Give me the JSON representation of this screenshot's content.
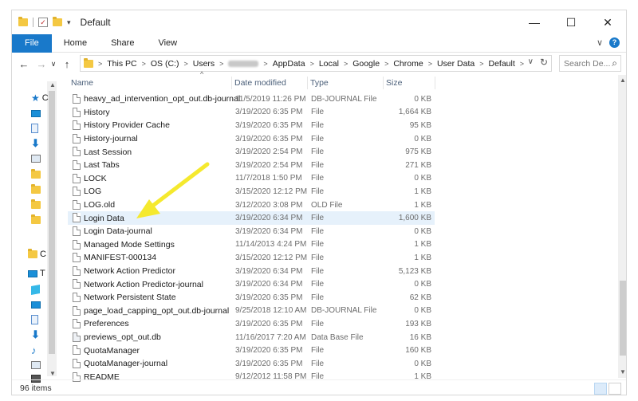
{
  "window": {
    "title": "Default",
    "minimize_glyph": "—",
    "maximize_glyph": "☐",
    "close_glyph": "✕"
  },
  "ribbon": {
    "tabs": [
      "File",
      "Home",
      "Share",
      "View"
    ],
    "collapse_glyph": "∨",
    "help_glyph": "?"
  },
  "nav": {
    "back_glyph": "←",
    "forward_glyph": "→",
    "recent_glyph": "∨",
    "up_glyph": "↑"
  },
  "address": {
    "crumbs": [
      "This PC",
      "OS (C:)",
      "Users",
      "",
      "AppData",
      "Local",
      "Google",
      "Chrome",
      "User Data",
      "Default"
    ],
    "dropdown_glyph": "∨",
    "refresh_glyph": "↻"
  },
  "search": {
    "placeholder": "Search De...",
    "icon_glyph": "⌕"
  },
  "navpane": {
    "items": [
      {
        "icon": "star-icon",
        "label": "C"
      },
      {
        "icon": "desktop-icon",
        "label": ""
      },
      {
        "icon": "documents-icon",
        "label": ""
      },
      {
        "icon": "downloads-icon",
        "label": ""
      },
      {
        "icon": "pictures-icon",
        "label": ""
      },
      {
        "icon": "folder-icon",
        "label": ""
      },
      {
        "icon": "folder-icon",
        "label": ""
      },
      {
        "icon": "folder-icon",
        "label": ""
      },
      {
        "icon": "folder-icon",
        "label": ""
      },
      {
        "icon": "folder-icon",
        "label": "C"
      },
      {
        "icon": "monitor-icon",
        "label": "T"
      },
      {
        "icon": "3d-objects-icon",
        "label": ""
      },
      {
        "icon": "desktop-icon",
        "label": ""
      },
      {
        "icon": "documents-icon",
        "label": ""
      },
      {
        "icon": "downloads-icon",
        "label": ""
      },
      {
        "icon": "music-icon",
        "label": ""
      },
      {
        "icon": "pictures-icon",
        "label": ""
      },
      {
        "icon": "videos-icon",
        "label": ""
      }
    ]
  },
  "columns": {
    "name": "Name",
    "date": "Date modified",
    "type": "Type",
    "size": "Size",
    "sort_glyph": "^"
  },
  "files": [
    {
      "name": "heavy_ad_intervention_opt_out.db-journal",
      "date": "11/5/2019 11:26 PM",
      "type": "DB-JOURNAL File",
      "size": "0 KB"
    },
    {
      "name": "History",
      "date": "3/19/2020 6:35 PM",
      "type": "File",
      "size": "1,664 KB"
    },
    {
      "name": "History Provider Cache",
      "date": "3/19/2020 6:35 PM",
      "type": "File",
      "size": "95 KB"
    },
    {
      "name": "History-journal",
      "date": "3/19/2020 6:35 PM",
      "type": "File",
      "size": "0 KB"
    },
    {
      "name": "Last Session",
      "date": "3/19/2020 2:54 PM",
      "type": "File",
      "size": "975 KB"
    },
    {
      "name": "Last Tabs",
      "date": "3/19/2020 2:54 PM",
      "type": "File",
      "size": "271 KB"
    },
    {
      "name": "LOCK",
      "date": "11/7/2018 1:50 PM",
      "type": "File",
      "size": "0 KB"
    },
    {
      "name": "LOG",
      "date": "3/15/2020 12:12 PM",
      "type": "File",
      "size": "1 KB"
    },
    {
      "name": "LOG.old",
      "date": "3/12/2020 3:08 PM",
      "type": "OLD File",
      "size": "1 KB"
    },
    {
      "name": "Login Data",
      "date": "3/19/2020 6:34 PM",
      "type": "File",
      "size": "1,600 KB"
    },
    {
      "name": "Login Data-journal",
      "date": "3/19/2020 6:34 PM",
      "type": "File",
      "size": "0 KB"
    },
    {
      "name": "Managed Mode Settings",
      "date": "11/14/2013 4:24 PM",
      "type": "File",
      "size": "1 KB"
    },
    {
      "name": "MANIFEST-000134",
      "date": "3/15/2020 12:12 PM",
      "type": "File",
      "size": "1 KB"
    },
    {
      "name": "Network Action Predictor",
      "date": "3/19/2020 6:34 PM",
      "type": "File",
      "size": "5,123 KB"
    },
    {
      "name": "Network Action Predictor-journal",
      "date": "3/19/2020 6:34 PM",
      "type": "File",
      "size": "0 KB"
    },
    {
      "name": "Network Persistent State",
      "date": "3/19/2020 6:35 PM",
      "type": "File",
      "size": "62 KB"
    },
    {
      "name": "page_load_capping_opt_out.db-journal",
      "date": "9/25/2018 12:10 AM",
      "type": "DB-JOURNAL File",
      "size": "0 KB"
    },
    {
      "name": "Preferences",
      "date": "3/19/2020 6:35 PM",
      "type": "File",
      "size": "193 KB"
    },
    {
      "name": "previews_opt_out.db",
      "date": "11/16/2017 7:20 AM",
      "type": "Data Base File",
      "size": "16 KB"
    },
    {
      "name": "QuotaManager",
      "date": "3/19/2020 6:35 PM",
      "type": "File",
      "size": "160 KB"
    },
    {
      "name": "QuotaManager-journal",
      "date": "3/19/2020 6:35 PM",
      "type": "File",
      "size": "0 KB"
    },
    {
      "name": "README",
      "date": "9/12/2012 11:58 PM",
      "type": "File",
      "size": "1 KB"
    }
  ],
  "selected_file": "Login Data",
  "status": {
    "item_count": "96 items"
  },
  "colors": {
    "accent": "#1979ca",
    "annotation_arrow": "#f5e92e",
    "selection": "#e6f1fb"
  }
}
